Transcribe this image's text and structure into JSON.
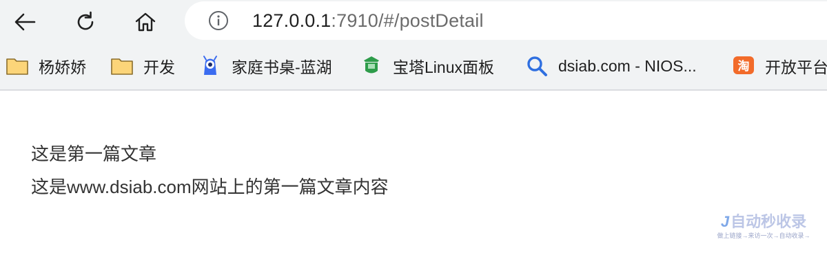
{
  "browser": {
    "url_host": "127.0.0.1",
    "url_rest": ":7910/#/postDetail"
  },
  "bookmarks": [
    {
      "label": "杨娇娇",
      "icon": "folder-icon"
    },
    {
      "label": "开发",
      "icon": "folder-icon"
    },
    {
      "label": "家庭书桌-蓝湖",
      "icon": "lanhu-icon"
    },
    {
      "label": "宝塔Linux面板",
      "icon": "baota-icon"
    },
    {
      "label": "dsiab.com - NIOS...",
      "icon": "magnifier-icon"
    },
    {
      "label": "开放平台",
      "icon": "taobao-icon"
    }
  ],
  "post": {
    "title": "这是第一篇文章",
    "body": "这是www.dsiab.com网站上的第一篇文章内容"
  },
  "watermark": {
    "logo_text": "J",
    "main": "自动秒收录",
    "sub": "做上链接→来访一次→自动收录→"
  },
  "colors": {
    "toolbar_bg": "#f1f3f4",
    "folder": "#fcd579",
    "watermark": "#bcc6e6"
  }
}
